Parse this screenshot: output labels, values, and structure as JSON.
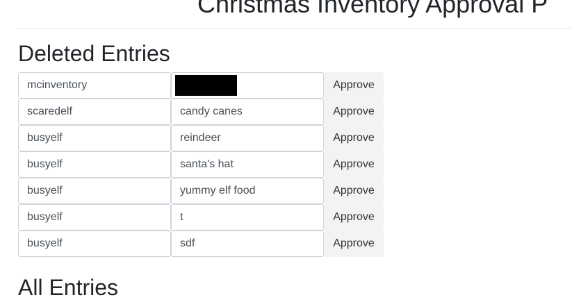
{
  "page": {
    "title": "Christmas Inventory Approval P"
  },
  "deleted": {
    "heading": "Deleted Entries",
    "approve_label": "Approve",
    "entries": [
      {
        "user": "mcinventory",
        "item": "",
        "redacted": true
      },
      {
        "user": "scaredelf",
        "item": "candy canes"
      },
      {
        "user": "busyelf",
        "item": "reindeer"
      },
      {
        "user": "busyelf",
        "item": "santa's hat"
      },
      {
        "user": "busyelf",
        "item": "yummy elf food"
      },
      {
        "user": "busyelf",
        "item": "t"
      },
      {
        "user": "busyelf",
        "item": "sdf"
      }
    ]
  },
  "all": {
    "heading": "All Entries"
  }
}
